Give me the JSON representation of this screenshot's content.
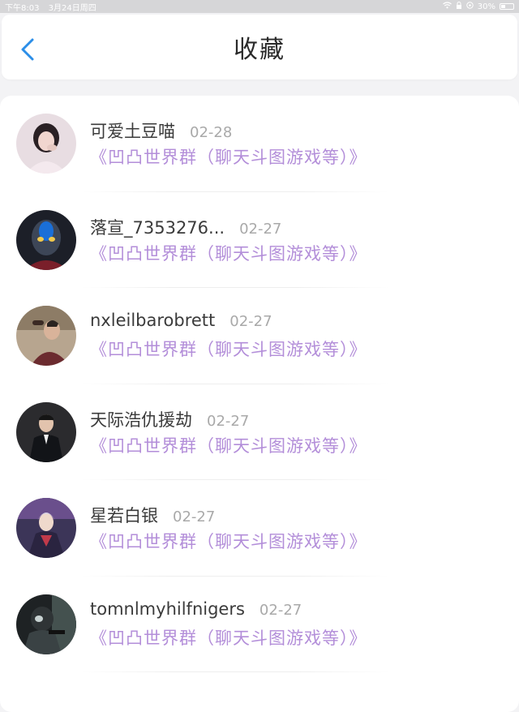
{
  "status_bar": {
    "time": "下午8:03",
    "date": "3月24日周四",
    "battery": "30%"
  },
  "header": {
    "title": "收藏",
    "back_icon": "chevron-left-icon"
  },
  "colors": {
    "accent": "#2c8ee8",
    "group_link": "#b38ed9",
    "date_gray": "#a9a9a9"
  },
  "items": [
    {
      "name": "可爱土豆喵",
      "date": "02-28",
      "group": "《凹凸世界群（聊天斗图游戏等）》"
    },
    {
      "name": "落宣_7353276...",
      "date": "02-27",
      "group": "《凹凸世界群（聊天斗图游戏等）》"
    },
    {
      "name": "nxleilbarobrett",
      "date": "02-27",
      "group": "《凹凸世界群（聊天斗图游戏等）》"
    },
    {
      "name": "天际浩仇援劫",
      "date": "02-27",
      "group": "《凹凸世界群（聊天斗图游戏等）》"
    },
    {
      "name": "星若白银",
      "date": "02-27",
      "group": "《凹凸世界群（聊天斗图游戏等）》"
    },
    {
      "name": "tomnlmyhilfnigers",
      "date": "02-27",
      "group": "《凹凸世界群（聊天斗图游戏等）》"
    }
  ]
}
